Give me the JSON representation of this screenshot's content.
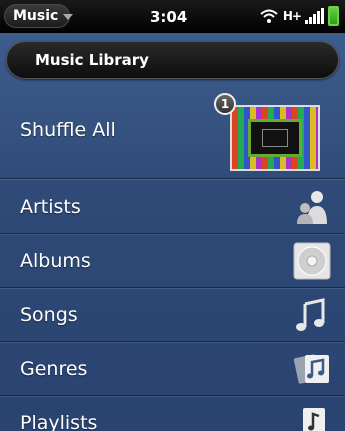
{
  "status_bar": {
    "app_menu_label": "Music",
    "time": "3:04",
    "network": "H+"
  },
  "header": {
    "title": "Music Library"
  },
  "shuffle": {
    "label": "Shuffle All",
    "badge_count": "1"
  },
  "menu": {
    "items": [
      {
        "label": "Artists",
        "icon": "artist-icon"
      },
      {
        "label": "Albums",
        "icon": "album-disc-icon"
      },
      {
        "label": "Songs",
        "icon": "music-notes-icon"
      },
      {
        "label": "Genres",
        "icon": "genres-icon"
      },
      {
        "label": "Playlists",
        "icon": "playlist-icon"
      }
    ]
  },
  "colors": {
    "background": "#2f4a77",
    "battery": "#5fd03c"
  }
}
